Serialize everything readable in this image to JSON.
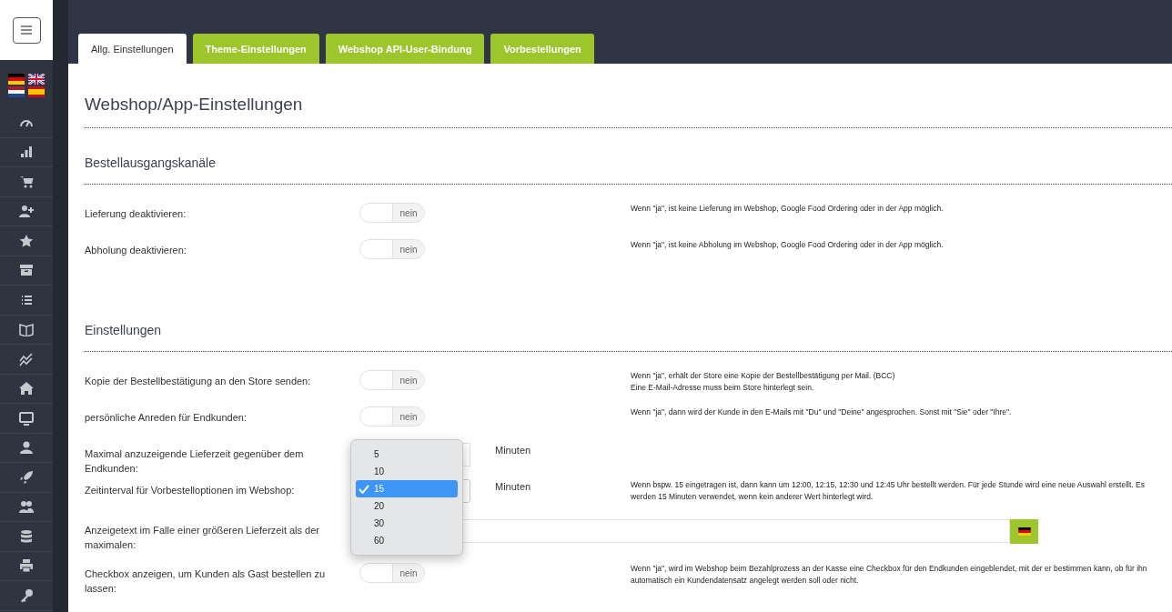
{
  "tabs": [
    {
      "label": "Allg. Einstellungen",
      "selected": true
    },
    {
      "label": "Theme-Einstellungen",
      "selected": false
    },
    {
      "label": "Webshop API-User-Bindung",
      "selected": false
    },
    {
      "label": "Vorbestellungen",
      "selected": false
    }
  ],
  "title": "Webshop/App-Einstellungen",
  "sections": [
    {
      "heading": "Bestellausgangskanäle",
      "rows": [
        {
          "kind": "toggle",
          "label": "Lieferung deaktivieren:",
          "on": false,
          "state_text": "nein",
          "help": [
            "Wenn \"ja\", ist keine Lieferung im Webshop, Google Food Ordering oder in der App möglich."
          ]
        },
        {
          "kind": "toggle",
          "label": "Abholung deaktivieren:",
          "on": false,
          "state_text": "nein",
          "help": [
            "Wenn \"ja\", ist keine Abholung im Webshop, Google Food Ordering oder in der App möglich."
          ]
        }
      ]
    },
    {
      "heading": "Einstellungen",
      "rows": [
        {
          "kind": "toggle",
          "label": "Kopie der Bestellbestätigung an den Store senden:",
          "on": false,
          "state_text": "nein",
          "help": [
            "Wenn \"ja\", erhält der Store eine Kopie der Bestellbestätigung per Mail. (BCC)",
            "Eine E-Mail-Adresse muss beim Store hinterlegt sein."
          ]
        },
        {
          "kind": "toggle",
          "label": "persönliche Anreden für Endkunden:",
          "on": false,
          "state_text": "nein",
          "help": [
            "Wenn \"ja\", dann wird der Kunde in den E-Mails mit \"Du\" und \"Deine\" angesprochen. Sonst mit \"Sie\" oder \"Ihre\"."
          ]
        },
        {
          "kind": "number",
          "label": "Maximal anzuzeigende Lieferzeit gegenüber dem Endkunden:",
          "unit": "Minuten"
        },
        {
          "kind": "select",
          "label": "Zeitinterval für Vorbestelloptionen im Webshop:",
          "unit": "Minuten",
          "options": [
            {
              "label": "5",
              "selected": false
            },
            {
              "label": "10",
              "selected": false
            },
            {
              "label": "15",
              "selected": true
            },
            {
              "label": "20",
              "selected": false
            },
            {
              "label": "30",
              "selected": false
            },
            {
              "label": "60",
              "selected": false
            }
          ],
          "help": [
            "Wenn bspw. 15 eingetragen ist, dann kann um 12:00, 12:15, 12:30 und 12:45 Uhr bestellt werden. Für jede Stunde wird eine neue Auswahl erstellt. Es werden 15 Minuten verwendet, wenn kein anderer Wert hinterlegt wird."
          ]
        },
        {
          "kind": "text",
          "label": "Anzeigetext im Falle einer größeren Lieferzeit als der maximalen:"
        },
        {
          "kind": "toggle",
          "label": "Checkbox anzeigen, um Kunden als Gast bestellen zu lassen:",
          "on": false,
          "state_text": "nein",
          "help": [
            "Wenn \"ja\", wird im Webshop beim Bezahlprozess an der Kasse eine Checkbox für den Endkunden eingeblendet, mit der er bestimmen kann, ob für ihn automatisch ein Kundendatensatz angelegt werden soll oder nicht."
          ]
        }
      ]
    }
  ]
}
